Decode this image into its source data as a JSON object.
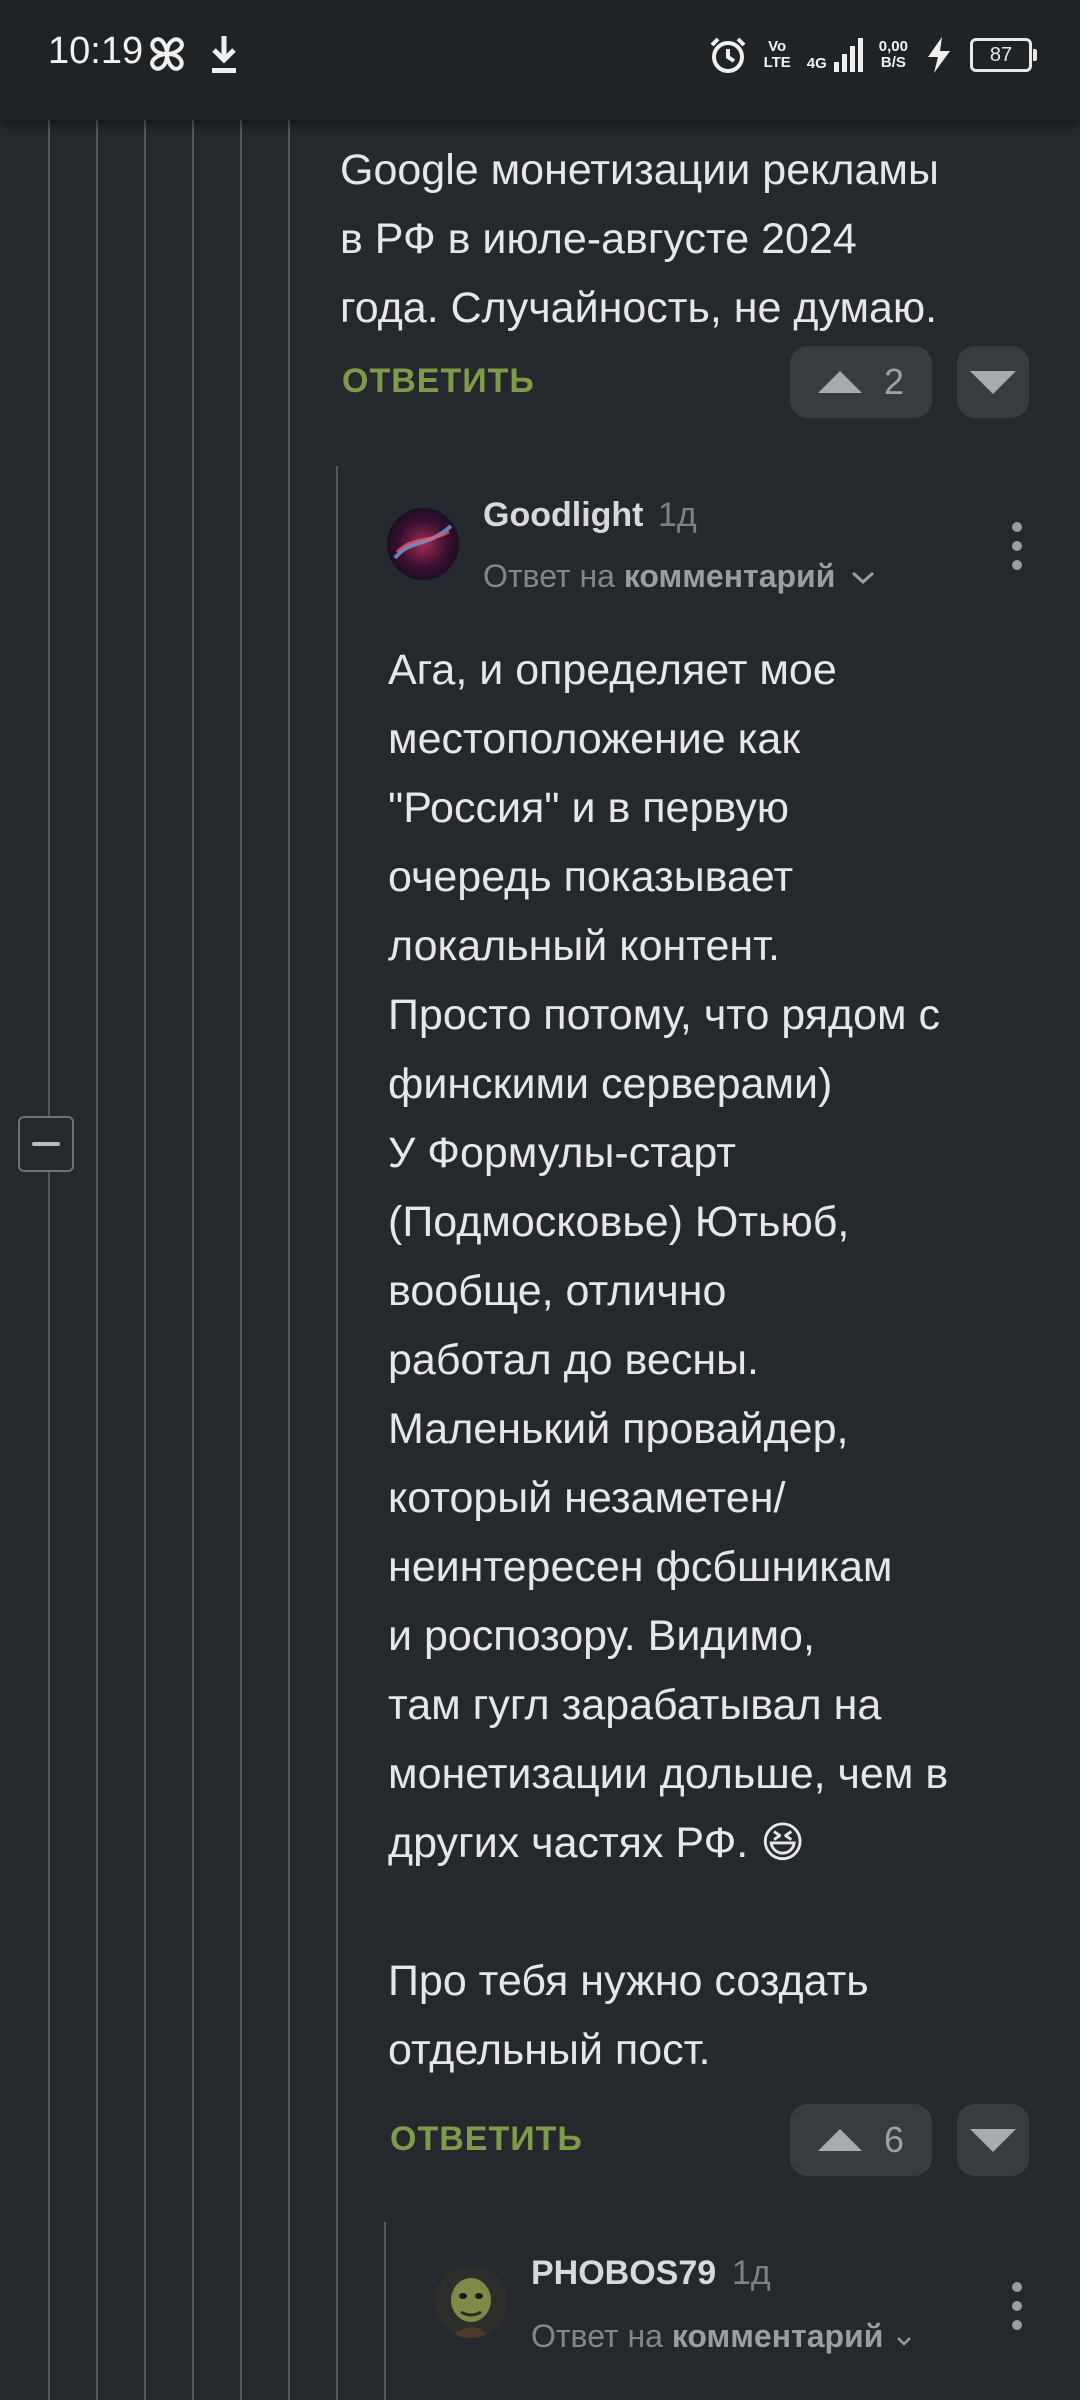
{
  "status_bar": {
    "time": "10:19",
    "volte_top": "Vo",
    "volte_bottom": "LTE",
    "network": "4G",
    "net_speed_value": "0,00",
    "net_speed_unit": "B/S",
    "battery": "87"
  },
  "comment_top": {
    "text_lines": [
      "Google монетизации рекламы",
      "в РФ в июле-августе 2024",
      "года. Случайность, не думаю."
    ],
    "reply_label": "ОТВЕТИТЬ",
    "vote_count": "2"
  },
  "comment_goodlight": {
    "author": "Goodlight",
    "age": "1д",
    "reply_to_prefix": "Ответ на",
    "reply_to_target": "комментарий",
    "text_lines": [
      "Ага, и определяет мое",
      "местоположение как",
      "\"Россия\" и в первую",
      "очередь показывает",
      "локальный контент.",
      "Просто потому, что рядом с",
      "финскими серверами)",
      "У Формулы-старт",
      "(Подмосковье) Ютьюб,",
      "вообще, отлично",
      "работал до весны.",
      "Маленький провайдер,",
      "который незаметен/",
      "неинтересен фсбшникам",
      "и роспозору. Видимо,",
      "там гугл зарабатывал на",
      "монетизации дольше, чем в",
      "других частях РФ. 😆",
      "",
      "Про тебя нужно создать",
      "отдельный пост."
    ],
    "reply_label": "ОТВЕТИТЬ",
    "vote_count": "6"
  },
  "comment_phobos": {
    "author": "PHOBOS79",
    "age": "1д",
    "reply_to_prefix": "Ответ на",
    "reply_to_target": "комментарий"
  },
  "icons": {
    "collapse": "minus-icon",
    "upvote": "triangle-up-icon",
    "downvote": "triangle-down-icon",
    "menu": "kebab-menu-icon",
    "chevron": "chevron-down-icon"
  },
  "colors": {
    "background": "#25282c",
    "reply_green": "#7f9b49",
    "vote_bg": "#383c41"
  }
}
